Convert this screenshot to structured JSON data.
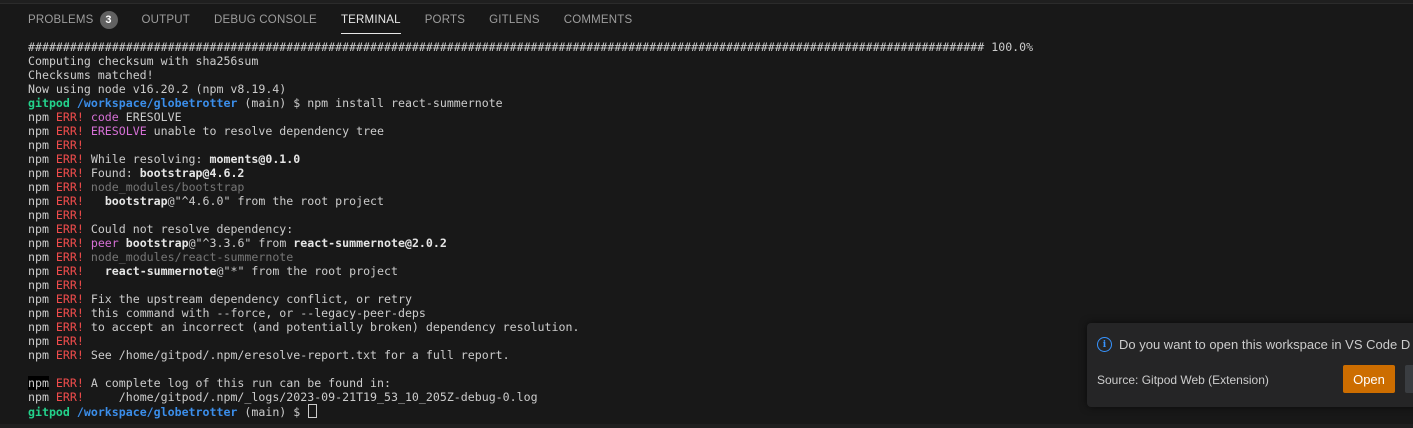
{
  "panel": {
    "tabs": [
      {
        "label": "PROBLEMS",
        "badge": "3",
        "active": false
      },
      {
        "label": "OUTPUT",
        "active": false
      },
      {
        "label": "DEBUG CONSOLE",
        "active": false
      },
      {
        "label": "TERMINAL",
        "active": true
      },
      {
        "label": "PORTS",
        "active": false
      },
      {
        "label": "GITLENS",
        "active": false
      },
      {
        "label": "COMMENTS",
        "active": false
      }
    ]
  },
  "terminal": {
    "progress_line": "######################################################################################################################################### 100.0%",
    "progress_value": 100.0,
    "lines": [
      {
        "segments": [
          {
            "t": "######################################################################################################################################### 100.0%",
            "c": "default"
          }
        ]
      },
      {
        "segments": [
          {
            "t": "Computing checksum with sha256sum",
            "c": "default"
          }
        ]
      },
      {
        "segments": [
          {
            "t": "Checksums matched!",
            "c": "default"
          }
        ]
      },
      {
        "segments": [
          {
            "t": "Now using node v16.20.2 (npm v8.19.4)",
            "c": "default"
          }
        ]
      },
      {
        "segments": [
          {
            "t": "gitpod",
            "c": "green"
          },
          {
            "t": " ",
            "c": "default"
          },
          {
            "t": "/workspace/globetrotter",
            "c": "blue"
          },
          {
            "t": " (main) $ npm install react-summernote",
            "c": "default"
          }
        ]
      },
      {
        "segments": [
          {
            "t": "npm",
            "c": "default"
          },
          {
            "t": " ERR!",
            "c": "red"
          },
          {
            "t": " ",
            "c": "default"
          },
          {
            "t": "code",
            "c": "magenta"
          },
          {
            "t": " ERESOLVE",
            "c": "default"
          }
        ]
      },
      {
        "segments": [
          {
            "t": "npm",
            "c": "default"
          },
          {
            "t": " ERR!",
            "c": "red"
          },
          {
            "t": " ",
            "c": "default"
          },
          {
            "t": "ERESOLVE",
            "c": "magenta"
          },
          {
            "t": " unable to resolve dependency tree",
            "c": "default"
          }
        ]
      },
      {
        "segments": [
          {
            "t": "npm",
            "c": "default"
          },
          {
            "t": " ERR!",
            "c": "red"
          }
        ]
      },
      {
        "segments": [
          {
            "t": "npm",
            "c": "default"
          },
          {
            "t": " ERR!",
            "c": "red"
          },
          {
            "t": " While resolving: ",
            "c": "default"
          },
          {
            "t": "moments@0.1.0",
            "c": "bold"
          }
        ]
      },
      {
        "segments": [
          {
            "t": "npm",
            "c": "default"
          },
          {
            "t": " ERR!",
            "c": "red"
          },
          {
            "t": " Found: ",
            "c": "default"
          },
          {
            "t": "bootstrap@4.6.2",
            "c": "bold"
          }
        ]
      },
      {
        "segments": [
          {
            "t": "npm",
            "c": "default"
          },
          {
            "t": " ERR!",
            "c": "red"
          },
          {
            "t": " ",
            "c": "default"
          },
          {
            "t": "node_modules/bootstrap",
            "c": "dim"
          }
        ]
      },
      {
        "segments": [
          {
            "t": "npm",
            "c": "default"
          },
          {
            "t": " ERR!",
            "c": "red"
          },
          {
            "t": "   ",
            "c": "default"
          },
          {
            "t": "bootstrap",
            "c": "bold"
          },
          {
            "t": "@\"^4.6.0\" from the root project",
            "c": "default"
          }
        ]
      },
      {
        "segments": [
          {
            "t": "npm",
            "c": "default"
          },
          {
            "t": " ERR!",
            "c": "red"
          }
        ]
      },
      {
        "segments": [
          {
            "t": "npm",
            "c": "default"
          },
          {
            "t": " ERR!",
            "c": "red"
          },
          {
            "t": " Could not resolve dependency:",
            "c": "default"
          }
        ]
      },
      {
        "segments": [
          {
            "t": "npm",
            "c": "default"
          },
          {
            "t": " ERR!",
            "c": "red"
          },
          {
            "t": " ",
            "c": "default"
          },
          {
            "t": "peer",
            "c": "magenta"
          },
          {
            "t": " ",
            "c": "default"
          },
          {
            "t": "bootstrap",
            "c": "bold"
          },
          {
            "t": "@\"^3.3.6\" from ",
            "c": "default"
          },
          {
            "t": "react-summernote@2.0.2",
            "c": "bold"
          }
        ]
      },
      {
        "segments": [
          {
            "t": "npm",
            "c": "default"
          },
          {
            "t": " ERR!",
            "c": "red"
          },
          {
            "t": " ",
            "c": "default"
          },
          {
            "t": "node_modules/react-summernote",
            "c": "dim"
          }
        ]
      },
      {
        "segments": [
          {
            "t": "npm",
            "c": "default"
          },
          {
            "t": " ERR!",
            "c": "red"
          },
          {
            "t": "   ",
            "c": "default"
          },
          {
            "t": "react-summernote",
            "c": "bold"
          },
          {
            "t": "@\"*\" from the root project",
            "c": "default"
          }
        ]
      },
      {
        "segments": [
          {
            "t": "npm",
            "c": "default"
          },
          {
            "t": " ERR!",
            "c": "red"
          }
        ]
      },
      {
        "segments": [
          {
            "t": "npm",
            "c": "default"
          },
          {
            "t": " ERR!",
            "c": "red"
          },
          {
            "t": " Fix the upstream dependency conflict, or retry",
            "c": "default"
          }
        ]
      },
      {
        "segments": [
          {
            "t": "npm",
            "c": "default"
          },
          {
            "t": " ERR!",
            "c": "red"
          },
          {
            "t": " this command with --force, or --legacy-peer-deps",
            "c": "default"
          }
        ]
      },
      {
        "segments": [
          {
            "t": "npm",
            "c": "default"
          },
          {
            "t": " ERR!",
            "c": "red"
          },
          {
            "t": " to accept an incorrect (and potentially broken) dependency resolution.",
            "c": "default"
          }
        ]
      },
      {
        "segments": [
          {
            "t": "npm",
            "c": "default"
          },
          {
            "t": " ERR!",
            "c": "red"
          }
        ]
      },
      {
        "segments": [
          {
            "t": "npm",
            "c": "default"
          },
          {
            "t": " ERR!",
            "c": "red"
          },
          {
            "t": " See /home/gitpod/.npm/eresolve-report.txt for a full report.",
            "c": "default"
          }
        ]
      },
      {
        "segments": [
          {
            "t": "",
            "c": "default"
          }
        ]
      },
      {
        "segments": [
          {
            "t": "npm",
            "c": "bg"
          },
          {
            "t": " ERR!",
            "c": "red"
          },
          {
            "t": " A complete log of this run can be found in:",
            "c": "default"
          }
        ]
      },
      {
        "segments": [
          {
            "t": "npm",
            "c": "default"
          },
          {
            "t": " ERR!",
            "c": "red"
          },
          {
            "t": "     /home/gitpod/.npm/_logs/2023-09-21T19_53_10_205Z-debug-0.log",
            "c": "default"
          }
        ]
      },
      {
        "segments": [
          {
            "t": "gitpod",
            "c": "green"
          },
          {
            "t": " ",
            "c": "default"
          },
          {
            "t": "/workspace/globetrotter",
            "c": "blue"
          },
          {
            "t": " (main) $ ",
            "c": "default"
          }
        ],
        "cursor": true
      }
    ]
  },
  "notification": {
    "icon": "info-icon",
    "message": "Do you want to open this workspace in VS Code D",
    "source": "Source: Gitpod Web (Extension)",
    "open_label": "Open",
    "accent": "#cc6d00"
  },
  "colors": {
    "background": "#181818",
    "prompt_user": "#23d18b",
    "prompt_path": "#3b8eea",
    "error": "#f14c4c",
    "keyword": "#d670d6"
  }
}
